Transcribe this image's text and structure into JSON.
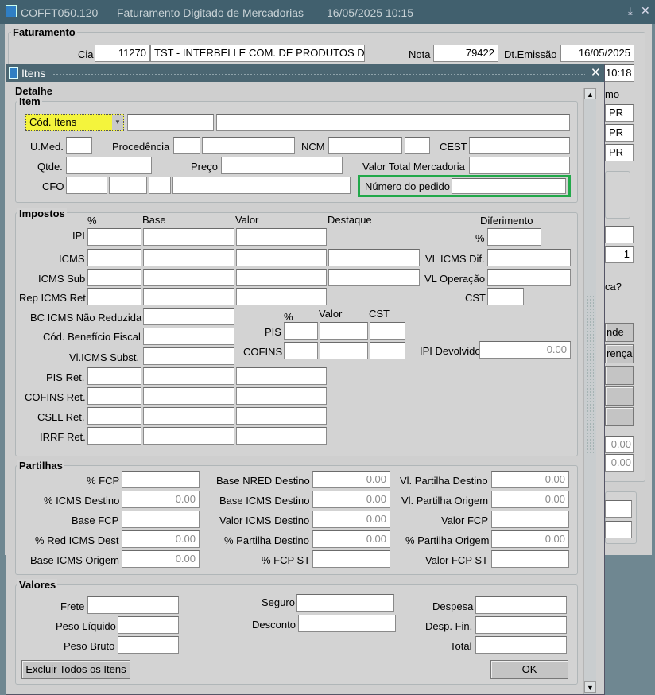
{
  "bg": {
    "title": "COFFT050.120",
    "subtitle": "Faturamento Digitado de Mercadorias",
    "datetime": "16/05/2025 10:15",
    "group_faturamento": "Faturamento",
    "cia_label": "Cia",
    "cia_code": "11270",
    "cia_name": "TST - INTERBELLE COM. DE PRODUTOS DE",
    "nota_label": "Nota",
    "nota_value": "79422",
    "dt_emissao_label": "Dt.Emissão",
    "dt_emissao_value": "16/05/2025",
    "time_value": "10:18",
    "mo_partial": "mo",
    "uf_values": [
      "PR",
      "PR",
      "PR"
    ],
    "ca_partial": "ca?",
    "one_value": "1",
    "nde_partial": "nde",
    "renca_partial": "rença",
    "zero1": "0.00",
    "zero2": "0.00"
  },
  "dialog": {
    "title": "Itens",
    "detalhe": "Detalhe",
    "item": {
      "group": "Item",
      "cod_itens_select": "Cód. Itens",
      "umed": "U.Med.",
      "procedencia": "Procedência",
      "ncm": "NCM",
      "cest": "CEST",
      "qtde": "Qtde.",
      "preco": "Preço",
      "valor_total": "Valor Total Mercadoria",
      "cfo": "CFO",
      "numero_pedido": "Número do pedido"
    },
    "impostos": {
      "group": "Impostos",
      "col_pct": "%",
      "col_base": "Base",
      "col_valor": "Valor",
      "col_destaque": "Destaque",
      "diferimento": "Diferimento",
      "pct": "%",
      "ipi": "IPI",
      "icms": "ICMS",
      "icms_sub": "ICMS Sub",
      "rep_icms_ret": "Rep ICMS Ret",
      "vl_icms_dif": "VL ICMS Dif.",
      "vl_operacao": "VL Operação",
      "cst": "CST",
      "bc_icms_nao_reduzida": "BC ICMS Não Reduzida",
      "cod_beneficio": "Cód. Benefício Fiscal",
      "vl_icms_subst": "Vl.ICMS Subst.",
      "pis_col_pct": "%",
      "pis_col_valor": "Valor",
      "pis_col_cst": "CST",
      "pis": "PIS",
      "cofins": "COFINS",
      "ipi_devolvido": "IPI Devolvido",
      "ipi_devolvido_value": "0.00",
      "pis_ret": "PIS Ret.",
      "cofins_ret": "COFINS Ret.",
      "csll_ret": "CSLL Ret.",
      "irrf_ret": "IRRF Ret."
    },
    "partilhas": {
      "group": "Partilhas",
      "pct_fcp": "% FCP",
      "pct_icms_destino": "% ICMS Destino",
      "pct_icms_destino_value": "0.00",
      "base_fcp": "Base FCP",
      "pct_red_icms_dest": "% Red ICMS Dest",
      "pct_red_icms_dest_value": "0.00",
      "base_icms_origem": "Base ICMS Origem",
      "base_icms_origem_value": "0.00",
      "base_nred_destino": "Base NRED Destino",
      "base_nred_destino_value": "0.00",
      "base_icms_destino": "Base ICMS Destino",
      "base_icms_destino_value": "0.00",
      "valor_icms_destino": "Valor ICMS Destino",
      "valor_icms_destino_value": "0.00",
      "pct_partilha_destino": "% Partilha Destino",
      "pct_partilha_destino_value": "0.00",
      "pct_fcp_st": "% FCP ST",
      "vl_partilha_destino": "Vl. Partilha Destino",
      "vl_partilha_destino_value": "0.00",
      "vl_partilha_origem": "Vl. Partilha Origem",
      "vl_partilha_origem_value": "0.00",
      "valor_fcp": "Valor FCP",
      "pct_partilha_origem": "% Partilha Origem",
      "pct_partilha_origem_value": "0.00",
      "valor_fcp_st": "Valor FCP ST"
    },
    "valores": {
      "group": "Valores",
      "frete": "Frete",
      "peso_liquido": "Peso Líquido",
      "peso_bruto": "Peso Bruto",
      "seguro": "Seguro",
      "desconto": "Desconto",
      "despesa": "Despesa",
      "desp_fin": "Desp. Fin.",
      "total": "Total"
    },
    "buttons": {
      "excluir": "Excluir Todos os Itens",
      "ok": "OK"
    }
  },
  "colors": {
    "title_bar": "#4b6672",
    "highlight_border": "#22a84a",
    "select_yellow": "#f4f43c"
  }
}
